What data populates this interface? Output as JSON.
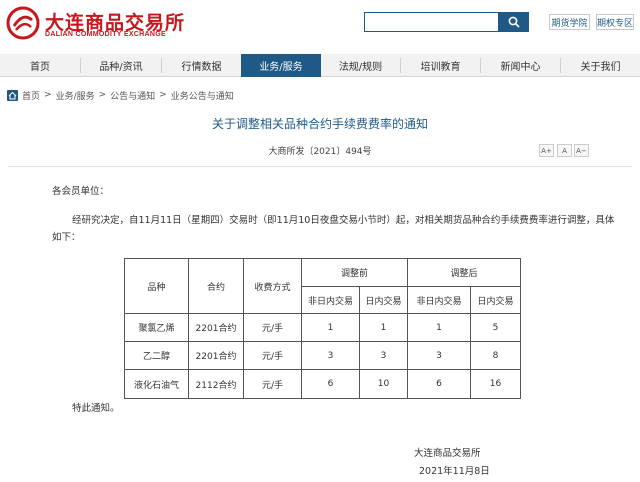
{
  "header": {
    "brand_cn": "大连商品交易所",
    "brand_en": "DALIAN COMMODITY EXCHANGE",
    "search_placeholder": "",
    "links": [
      "期货学院",
      "期权专区"
    ]
  },
  "nav": {
    "items": [
      "首页",
      "品种/资讯",
      "行情数据",
      "业务/服务",
      "法规/规则",
      "培训教育",
      "新闻中心",
      "关于我们"
    ],
    "active": "业务/服务"
  },
  "breadcrumb": [
    "首页",
    "业务/服务",
    "公告与通知",
    "业务公告与通知"
  ],
  "breadcrumb_sep": ">",
  "article": {
    "title": "关于调整相关品种合约手续费费率的通知",
    "doc_no": "大商所发〔2021〕494号",
    "font_controls": [
      "A+",
      "A",
      "A−"
    ],
    "salutation": "各会员单位：",
    "body_line1": "经研究决定，自11月11日（星期四）交易时（即11月10日夜盘交易小节时）起，对相关期货品种合约手续费费率进行调整，具体",
    "body_line2": "如下：",
    "closing": "特此通知。",
    "signature": "大连商品交易所",
    "date": "2021年11月8日"
  },
  "table": {
    "headers": {
      "variety": "品种",
      "contract": "合约",
      "method": "收费方式",
      "before": "调整前",
      "after": "调整后",
      "non_intraday": "非日内交易",
      "intraday": "日内交易"
    },
    "rows": [
      {
        "variety": "聚氯乙烯",
        "contract": "2201合约",
        "method": "元/手",
        "before_non": "1",
        "before_intra": "1",
        "after_non": "1",
        "after_intra": "5"
      },
      {
        "variety": "乙二醇",
        "contract": "2201合约",
        "method": "元/手",
        "before_non": "3",
        "before_intra": "3",
        "after_non": "3",
        "after_intra": "8"
      },
      {
        "variety": "液化石油气",
        "contract": "2112合约",
        "method": "元/手",
        "before_non": "6",
        "before_intra": "10",
        "after_non": "6",
        "after_intra": "16"
      }
    ]
  },
  "colors": {
    "brand_red": "#c8161d",
    "nav_active": "#1f5a87",
    "title_blue": "#1f5a87"
  }
}
